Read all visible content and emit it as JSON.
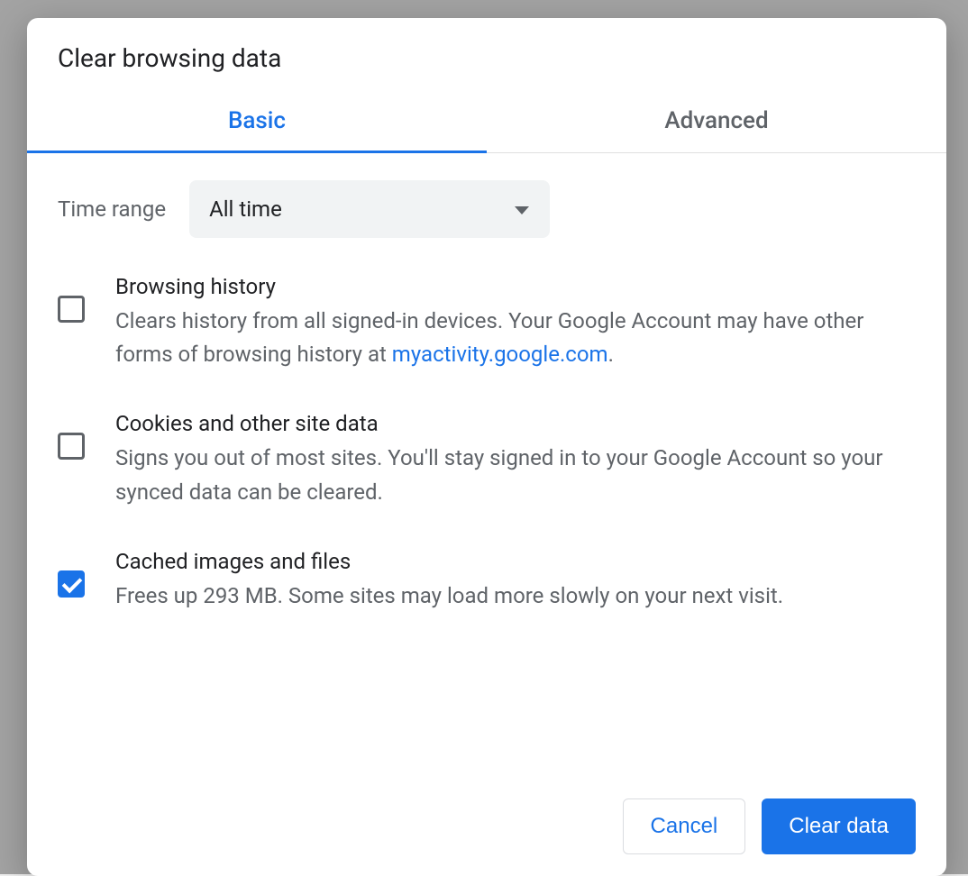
{
  "dialog": {
    "title": "Clear browsing data",
    "tabs": {
      "basic": "Basic",
      "advanced": "Advanced",
      "active": "basic"
    },
    "timeRange": {
      "label": "Time range",
      "value": "All time"
    },
    "options": [
      {
        "checked": false,
        "title": "Browsing history",
        "descPre": "Clears history from all signed-in devices. Your Google Account may have other forms of browsing history at ",
        "link": "myactivity.google.com",
        "descPost": "."
      },
      {
        "checked": false,
        "title": "Cookies and other site data",
        "desc": "Signs you out of most sites. You'll stay signed in to your Google Account so your synced data can be cleared."
      },
      {
        "checked": true,
        "title": "Cached images and files",
        "desc": "Frees up 293 MB. Some sites may load more slowly on your next visit."
      }
    ],
    "buttons": {
      "cancel": "Cancel",
      "confirm": "Clear data"
    }
  }
}
